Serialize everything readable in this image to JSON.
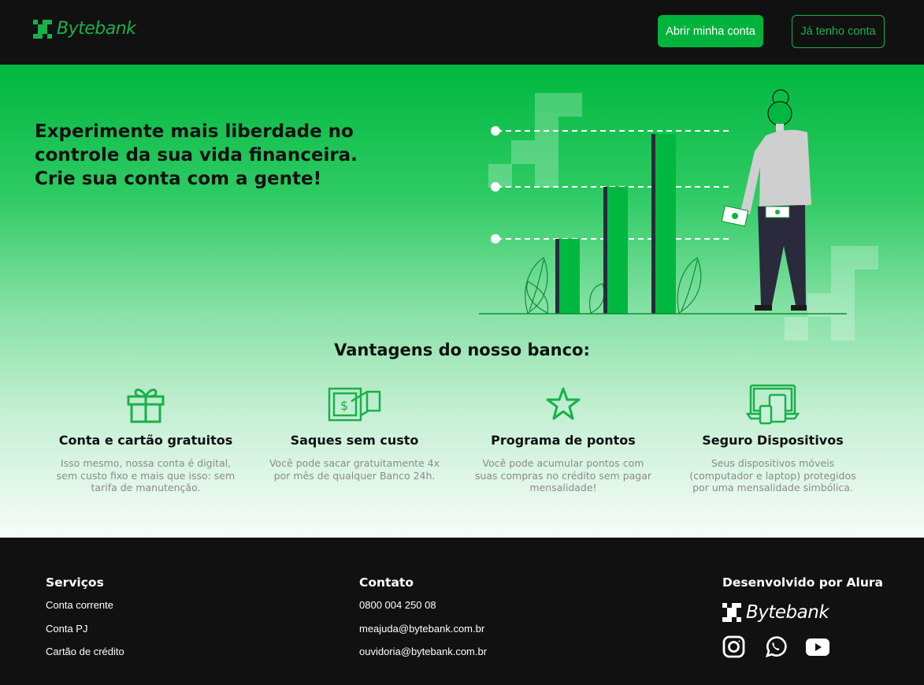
{
  "header": {
    "brand": "Bytebank",
    "open_account_label": "Abrir minha conta",
    "login_label": "Já tenho conta"
  },
  "hero": {
    "title_lines": [
      "Experimente mais liberdade no",
      "controle da sua vida financeira.",
      "Crie sua conta com a gente!"
    ]
  },
  "advantages": {
    "title": "Vantagens do nosso banco:",
    "items": [
      {
        "icon": "gift-icon",
        "title": "Conta e cartão gratuitos",
        "text": "Isso mesmo, nossa conta é digital, sem custo fixo e mais que isso: sem tarifa de manutenção."
      },
      {
        "icon": "cash-withdraw-icon",
        "title": "Saques sem custo",
        "text": "Você pode sacar gratuitamente 4x por mês de qualquer Banco 24h."
      },
      {
        "icon": "star-icon",
        "title": "Programa de pontos",
        "text": "Você pode acumular pontos com suas compras no crédito sem pagar mensalidade!"
      },
      {
        "icon": "devices-icon",
        "title": "Seguro Dispositivos",
        "text": "Seus dispositivos móveis (computador e laptop) protegidos por uma mensalidade simbólica."
      }
    ]
  },
  "footer": {
    "services": {
      "title": "Serviços",
      "items": [
        "Conta corrente",
        "Conta PJ",
        "Cartão de crédito"
      ]
    },
    "contact": {
      "title": "Contato",
      "items": [
        "0800 004 250 08",
        "meajuda@bytebank.com.br",
        "ouvidoria@bytebank.com.br"
      ]
    },
    "developed": {
      "title": "Desenvolvido por Alura",
      "brand": "Bytebank",
      "social": [
        "instagram-icon",
        "whatsapp-icon",
        "youtube-icon"
      ]
    }
  },
  "colors": {
    "brand_green": "#00b33c",
    "dark": "#111111",
    "text_muted": "#8a8a8a"
  }
}
